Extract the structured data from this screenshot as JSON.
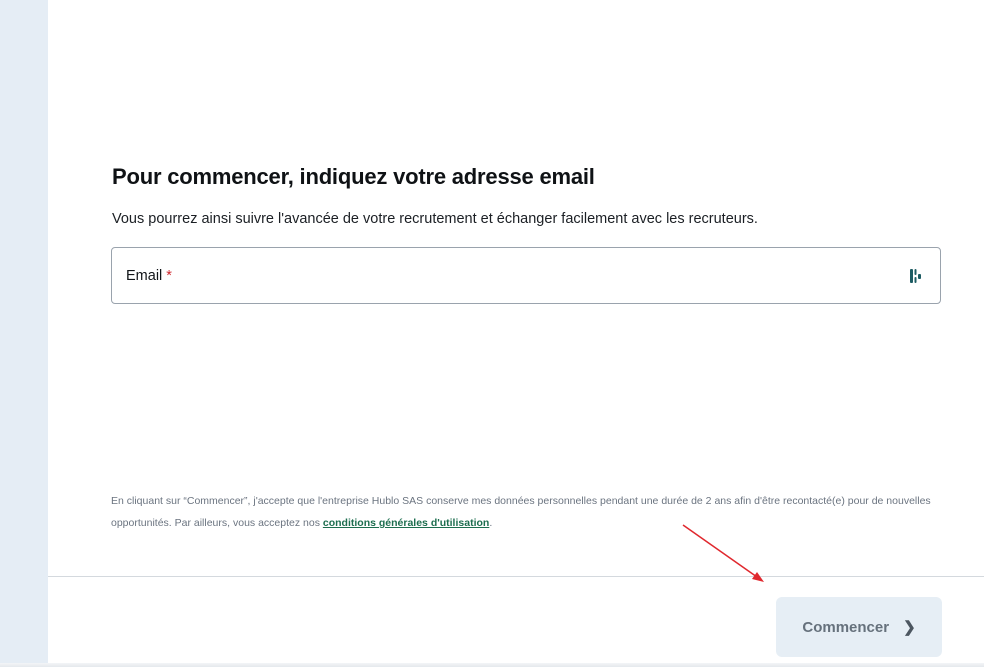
{
  "page": {
    "title": "Pour commencer, indiquez votre adresse email",
    "subtitle": "Vous pourrez ainsi suivre l'avancée de votre recrutement et échanger facilement avec les recruteurs."
  },
  "email_field": {
    "label": "Email",
    "required_marker": "*",
    "value": "",
    "icon": "password-manager-icon"
  },
  "legal": {
    "text_before": "En cliquant sur “Commencer”, j'accepte que l'entreprise Hublo SAS conserve mes données personnelles pendant une durée de 2 ans afin d'être recontacté(e) pour de nouvelles opportunités. Par ailleurs, vous acceptez nos ",
    "link_text": "conditions générales d'utilisation",
    "text_after": "."
  },
  "footer": {
    "start_button_label": "Commencer",
    "start_button_icon": "chevron-right-icon"
  },
  "colors": {
    "accent_link": "#1d6e4f",
    "required": "#d0282e",
    "button_bg": "#e6eef5",
    "annotation_arrow": "#e0282e"
  }
}
